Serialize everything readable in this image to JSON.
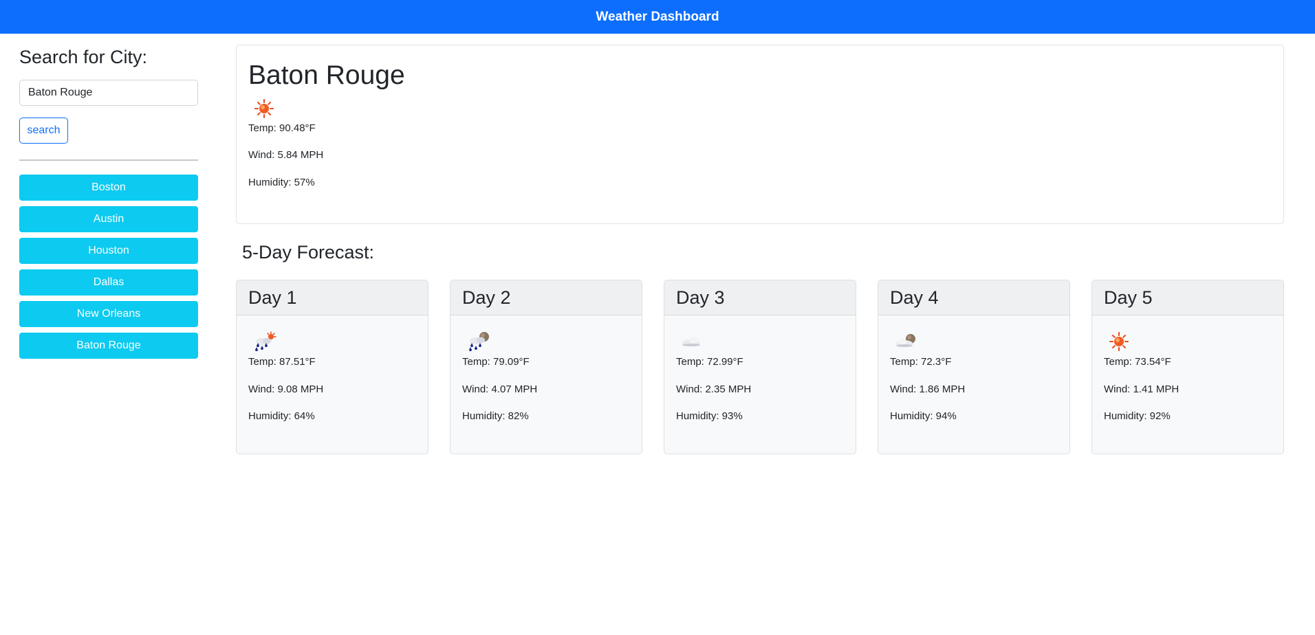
{
  "header": {
    "title": "Weather Dashboard"
  },
  "search": {
    "heading": "Search for City:",
    "input_value": "Baton Rouge",
    "button_label": "search"
  },
  "history": [
    {
      "label": "Boston"
    },
    {
      "label": "Austin"
    },
    {
      "label": "Houston"
    },
    {
      "label": "Dallas"
    },
    {
      "label": "New Orleans"
    },
    {
      "label": "Baton Rouge"
    }
  ],
  "current": {
    "city": "Baton Rouge",
    "icon": "sun-icon",
    "temp": "Temp: 90.48°F",
    "wind": "Wind: 5.84 MPH",
    "humidity": "Humidity: 57%"
  },
  "forecast": {
    "heading": "5-Day Forecast:",
    "days": [
      {
        "label": "Day 1",
        "icon": "rain-sun-icon",
        "temp": "Temp: 87.51°F",
        "wind": "Wind: 9.08 MPH",
        "humidity": "Humidity: 64%"
      },
      {
        "label": "Day 2",
        "icon": "rain-moon-icon",
        "temp": "Temp: 79.09°F",
        "wind": "Wind: 4.07 MPH",
        "humidity": "Humidity: 82%"
      },
      {
        "label": "Day 3",
        "icon": "cloud-icon",
        "temp": "Temp: 72.99°F",
        "wind": "Wind: 2.35 MPH",
        "humidity": "Humidity: 93%"
      },
      {
        "label": "Day 4",
        "icon": "cloud-moon-icon",
        "temp": "Temp: 72.3°F",
        "wind": "Wind: 1.86 MPH",
        "humidity": "Humidity: 94%"
      },
      {
        "label": "Day 5",
        "icon": "sun-icon",
        "temp": "Temp: 73.54°F",
        "wind": "Wind: 1.41 MPH",
        "humidity": "Humidity: 92%"
      }
    ]
  },
  "colors": {
    "navbar": "#0d6efd",
    "history_button": "#0dcaf0",
    "search_button_border": "#0d6efd"
  }
}
